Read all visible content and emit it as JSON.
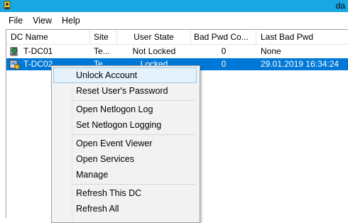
{
  "window": {
    "title_fragment": "da",
    "accent": "#19a7e3"
  },
  "menubar": {
    "items": [
      "File",
      "View",
      "Help"
    ]
  },
  "table": {
    "columns": [
      "DC Name",
      "Site",
      "User State",
      "Bad Pwd Co...",
      "Last Bad Pwd"
    ],
    "rows": [
      {
        "name": "T-DC01",
        "site": "Te...",
        "state": "Not Locked",
        "bad": "0",
        "last": "None",
        "icon": "domain-controller-icon",
        "selected": false
      },
      {
        "name": "T-DC02",
        "site": "Te...",
        "state": "Locked",
        "bad": "0",
        "last": "29.01.2019 16:34:24",
        "icon": "locked-dc-icon",
        "selected": true
      }
    ],
    "selection_color": "#0078d7"
  },
  "context_menu": {
    "items": [
      "Unlock Account",
      "Reset User's Password",
      "Open Netlogon Log",
      "Set Netlogon Logging",
      "Open Event Viewer",
      "Open Services",
      "Manage",
      "Refresh This DC",
      "Refresh All"
    ],
    "hover_index": 0
  }
}
